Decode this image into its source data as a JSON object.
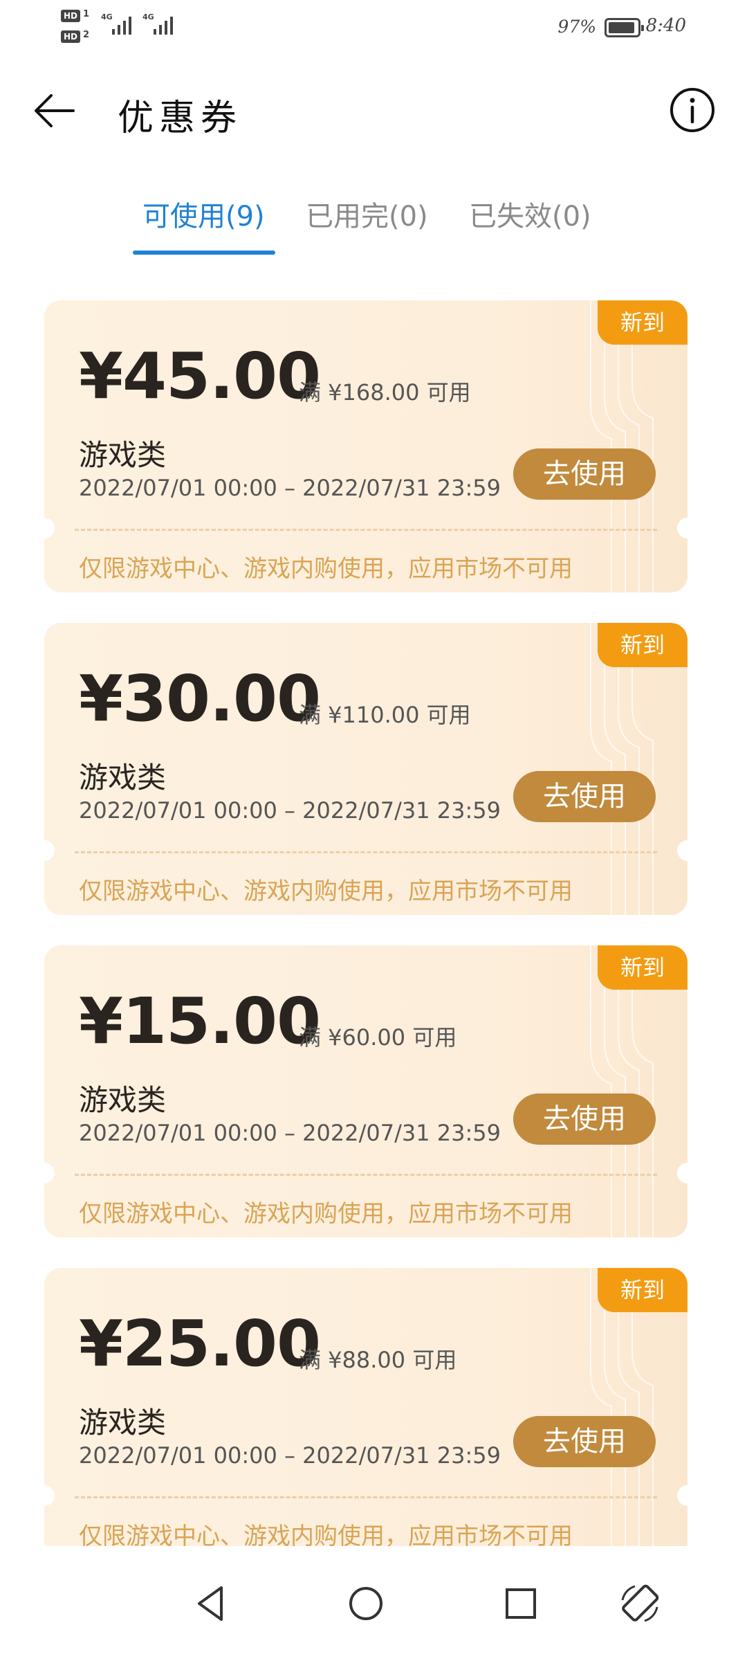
{
  "status_bar": {
    "sim1_badge": "HD",
    "sim1_num": "1",
    "sim2_badge": "HD",
    "sim2_num": "2",
    "network1": "4G",
    "network2": "4G",
    "battery": "97%",
    "time": "8:40"
  },
  "app_bar": {
    "title": "优惠券",
    "back_icon": "back-arrow-icon",
    "info_icon": "info-icon"
  },
  "tabs": [
    {
      "label": "可使用(9)",
      "active": true
    },
    {
      "label": "已用完(0)",
      "active": false
    },
    {
      "label": "已失效(0)",
      "active": false
    }
  ],
  "colors": {
    "accent": "#1e82d6",
    "badge": "#f39c12",
    "use_button": "#c18a3d",
    "coupon_bg": "#fdf1e0",
    "restriction_text": "#d9a454"
  },
  "coupons": [
    {
      "badge": "新到",
      "amount": "¥45.00",
      "condition": "满 ¥168.00 可用",
      "category": "游戏类",
      "period": "2022/07/01 00:00 – 2022/07/31 23:59",
      "action": "去使用",
      "restriction": "仅限游戏中心、游戏内购使用，应用市场不可用"
    },
    {
      "badge": "新到",
      "amount": "¥30.00",
      "condition": "满 ¥110.00 可用",
      "category": "游戏类",
      "period": "2022/07/01 00:00 – 2022/07/31 23:59",
      "action": "去使用",
      "restriction": "仅限游戏中心、游戏内购使用，应用市场不可用"
    },
    {
      "badge": "新到",
      "amount": "¥15.00",
      "condition": "满 ¥60.00 可用",
      "category": "游戏类",
      "period": "2022/07/01 00:00 – 2022/07/31 23:59",
      "action": "去使用",
      "restriction": "仅限游戏中心、游戏内购使用，应用市场不可用"
    },
    {
      "badge": "新到",
      "amount": "¥25.00",
      "condition": "满 ¥88.00 可用",
      "category": "游戏类",
      "period": "2022/07/01 00:00 – 2022/07/31 23:59",
      "action": "去使用",
      "restriction": "仅限游戏中心、游戏内购使用，应用市场不可用"
    }
  ],
  "nav_bar": {
    "items": [
      "back-triangle-icon",
      "home-circle-icon",
      "recents-square-icon",
      "rotate-screen-icon"
    ]
  }
}
